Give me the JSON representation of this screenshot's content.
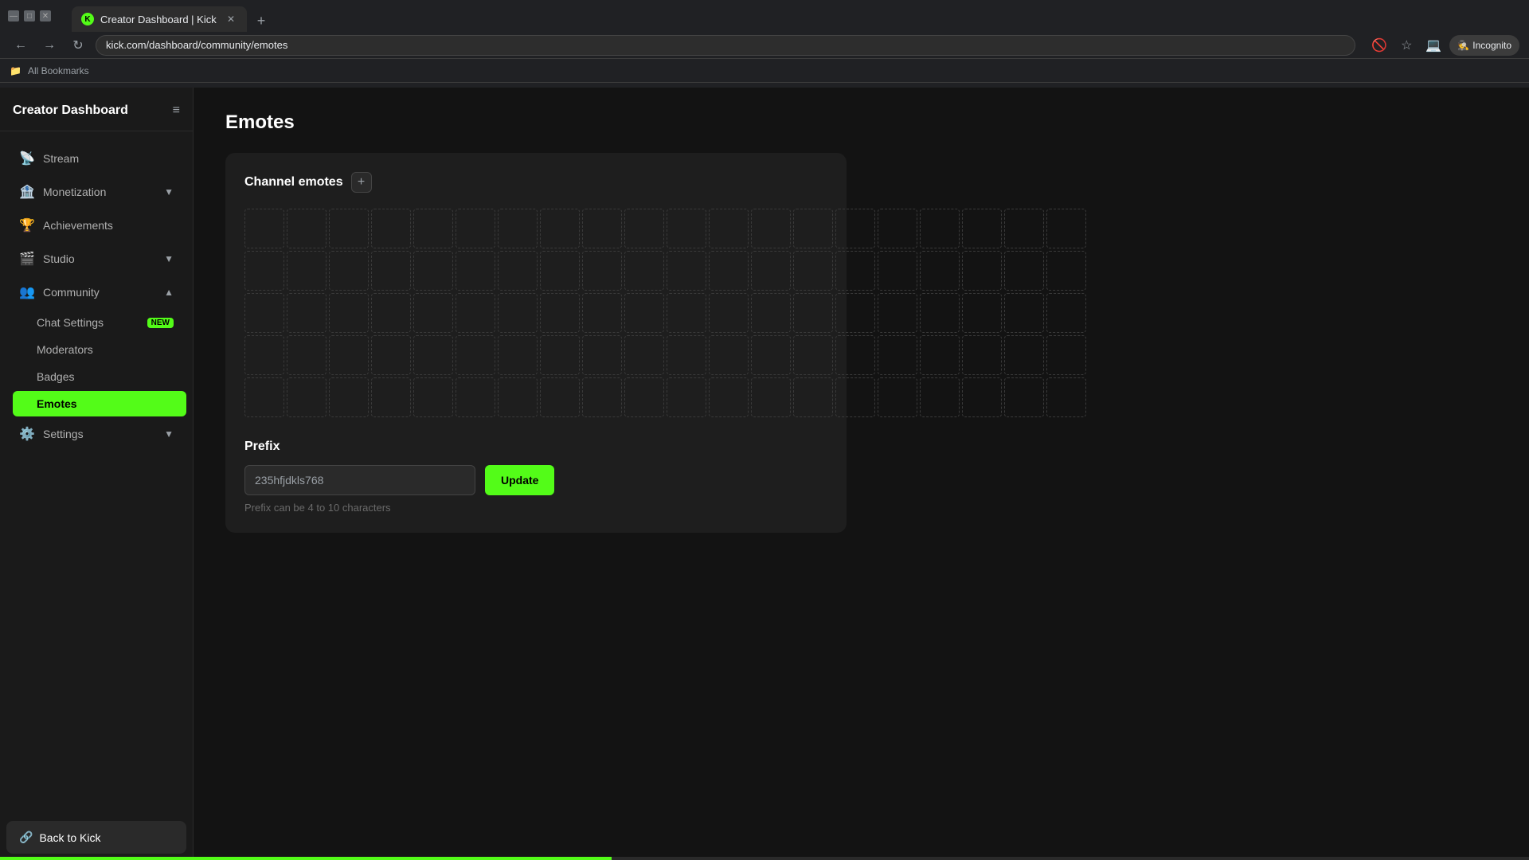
{
  "browser": {
    "tab_title": "Creator Dashboard | Kick",
    "tab_favicon": "K",
    "url": "kick.com/dashboard/community/emotes",
    "incognito_label": "Incognito",
    "bookmarks_label": "All Bookmarks"
  },
  "sidebar": {
    "title": "Creator Dashboard",
    "toggle_icon": "≡",
    "nav_items": [
      {
        "id": "stream",
        "label": "Stream",
        "icon": "📡"
      },
      {
        "id": "monetization",
        "label": "Monetization",
        "icon": "🏦",
        "expandable": true
      },
      {
        "id": "achievements",
        "label": "Achievements",
        "icon": "🏆"
      },
      {
        "id": "studio",
        "label": "Studio",
        "icon": "🎬",
        "expandable": true
      },
      {
        "id": "community",
        "label": "Community",
        "icon": "👥",
        "expandable": true,
        "expanded": true
      }
    ],
    "community_children": [
      {
        "id": "chat-settings",
        "label": "Chat Settings",
        "badge": "NEW"
      },
      {
        "id": "moderators",
        "label": "Moderators"
      },
      {
        "id": "badges",
        "label": "Badges"
      },
      {
        "id": "emotes",
        "label": "Emotes",
        "active": true
      }
    ],
    "settings": {
      "label": "Settings",
      "icon": "⚙️"
    },
    "back_to_kick": "Back to Kick"
  },
  "main": {
    "page_title": "Emotes",
    "channel_emotes_label": "Channel emotes",
    "add_button_label": "+",
    "emote_slot_count": 100,
    "prefix_section": {
      "title": "Prefix",
      "input_value": "235hfjdkls768",
      "update_button": "Update",
      "hint": "Prefix can be 4 to 10 characters"
    }
  }
}
